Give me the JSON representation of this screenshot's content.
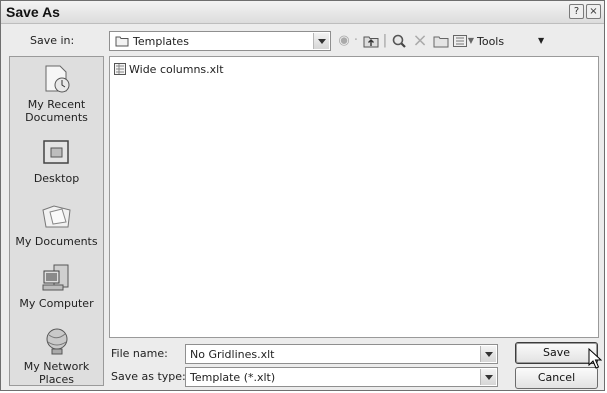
{
  "window": {
    "title": "Save As",
    "help_glyph": "?",
    "close_glyph": "×"
  },
  "toolbar": {
    "save_in_label": "Save in:",
    "location_value": "Templates",
    "tools_label": "Tools"
  },
  "places": [
    {
      "label_line1": "My Recent",
      "label_line2": "Documents",
      "icon": "recent-documents-icon"
    },
    {
      "label_line1": "Desktop",
      "label_line2": "",
      "icon": "desktop-icon"
    },
    {
      "label_line1": "My Documents",
      "label_line2": "",
      "icon": "my-documents-icon"
    },
    {
      "label_line1": "My Computer",
      "label_line2": "",
      "icon": "my-computer-icon"
    },
    {
      "label_line1": "My Network",
      "label_line2": "Places",
      "icon": "network-places-icon"
    }
  ],
  "files": [
    {
      "name": "Wide columns.xlt",
      "icon": "excel-template-icon"
    }
  ],
  "form": {
    "file_name_label": "File name:",
    "file_name_value": "No Gridlines.xlt",
    "save_as_type_label": "Save as type:",
    "save_as_type_value": "Template (*.xlt)"
  },
  "buttons": {
    "save": "Save",
    "cancel": "Cancel"
  }
}
